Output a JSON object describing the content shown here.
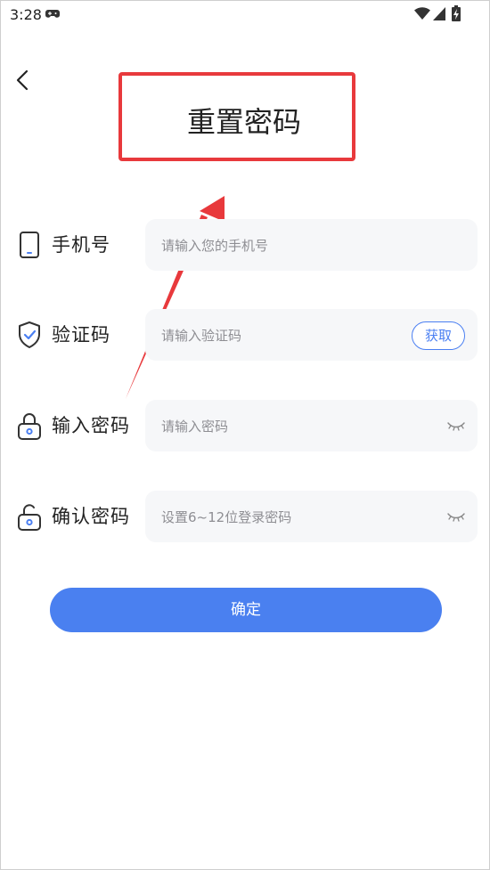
{
  "status_bar": {
    "time": "3:28"
  },
  "header": {
    "title": "重置密码"
  },
  "form": {
    "phone": {
      "label": "手机号",
      "placeholder": "请输入您的手机号",
      "value": ""
    },
    "code": {
      "label": "验证码",
      "placeholder": "请输入验证码",
      "value": "",
      "action_label": "获取"
    },
    "password": {
      "label": "输入密码",
      "placeholder": "请输入密码",
      "value": ""
    },
    "confirm_password": {
      "label": "确认密码",
      "placeholder": "设置6~12位登录密码",
      "value": ""
    }
  },
  "actions": {
    "confirm_label": "确定"
  },
  "colors": {
    "accent": "#4a80f0",
    "annotation": "#e8393c",
    "input_bg": "#f6f7f9"
  }
}
